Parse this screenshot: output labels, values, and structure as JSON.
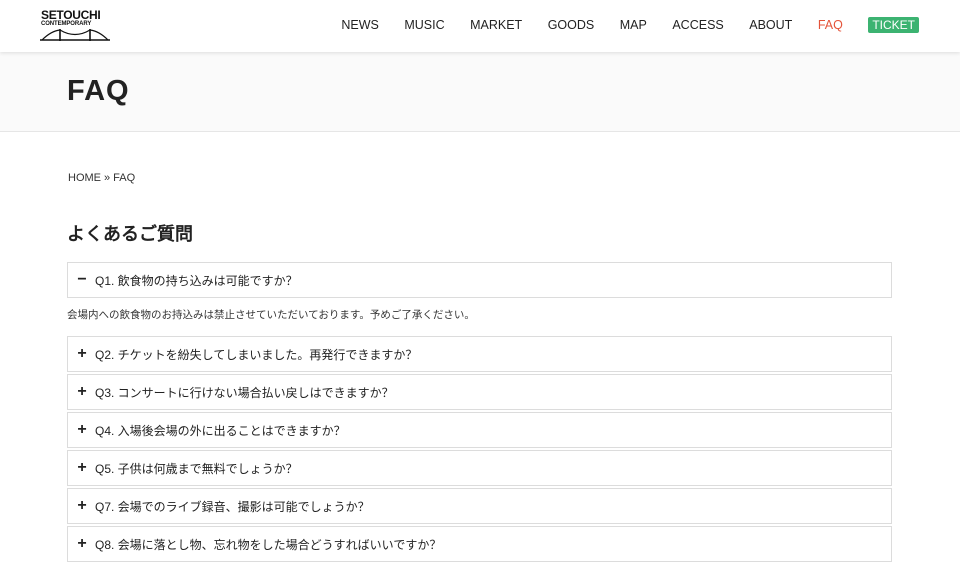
{
  "logo": {
    "main": "SETOUCHI",
    "sub": "CONTEMPORARY"
  },
  "nav": {
    "items": [
      {
        "label": "NEWS"
      },
      {
        "label": "MUSIC"
      },
      {
        "label": "MARKET"
      },
      {
        "label": "GOODS"
      },
      {
        "label": "MAP"
      },
      {
        "label": "ACCESS"
      },
      {
        "label": "ABOUT"
      },
      {
        "label": "FAQ",
        "active": true
      },
      {
        "label": "TICKET"
      }
    ],
    "active_color": "#e4543a",
    "ticket_color": "#3cb371"
  },
  "page": {
    "title": "FAQ"
  },
  "breadcrumb": {
    "home": "HOME",
    "sep": "»",
    "current": "FAQ"
  },
  "section": {
    "title": "よくあるご質問"
  },
  "faq": {
    "items": [
      {
        "sign": "−",
        "question": "Q1. 飲食物の持ち込みは可能ですか？",
        "answer": "会場内への飲食物のお持込みは禁止させていただいております。予めご了承ください。"
      },
      {
        "sign": "+",
        "question": "Q2. チケットを紛失してしまいました。再発行できますか？"
      },
      {
        "sign": "+",
        "question": "Q3. コンサートに行けない場合払い戻しはできますか？"
      },
      {
        "sign": "+",
        "question": "Q4. 入場後会場の外に出ることはできますか？"
      },
      {
        "sign": "+",
        "question": "Q5. 子供は何歳まで無料でしょうか？"
      },
      {
        "sign": "+",
        "question": "Q7. 会場でのライブ録音、撮影は可能でしょうか？"
      },
      {
        "sign": "+",
        "question": "Q8. 会場に落とし物、忘れ物をした場合どうすればいいですか？"
      }
    ]
  }
}
